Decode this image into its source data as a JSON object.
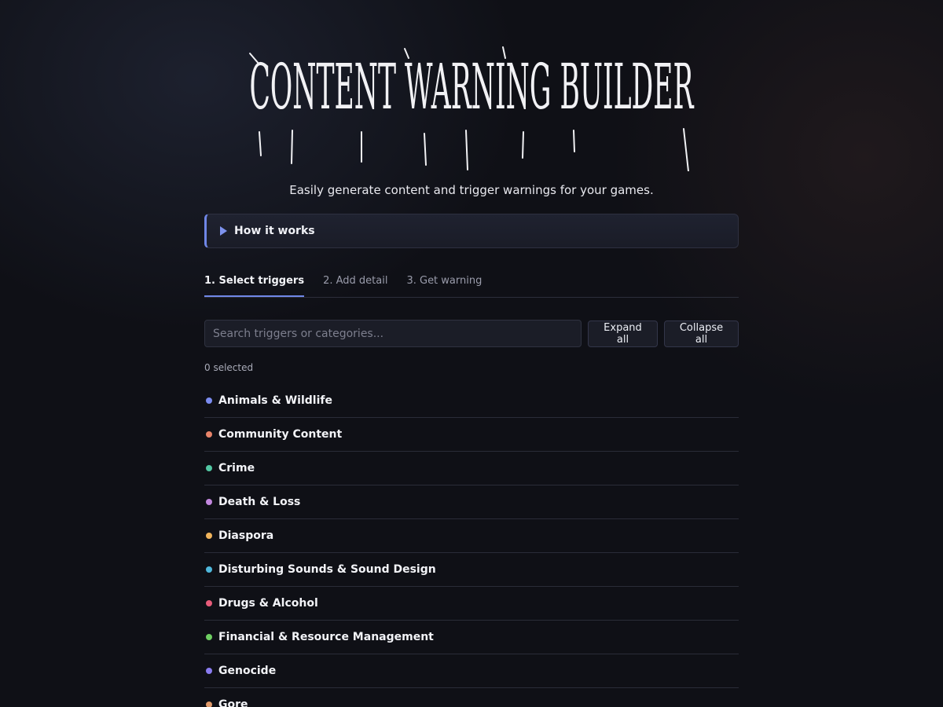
{
  "logo_text": "CONTENT WARNING BUILDER",
  "subtitle": "Easily generate content and trigger warnings for your games.",
  "how_it_works": {
    "label": "How it works"
  },
  "tabs": [
    {
      "label": "1. Select triggers",
      "active": true
    },
    {
      "label": "2. Add detail",
      "active": false
    },
    {
      "label": "3. Get warning",
      "active": false
    }
  ],
  "search": {
    "placeholder": "Search triggers or categories...",
    "value": ""
  },
  "buttons": {
    "expand_all": "Expand all",
    "collapse_all": "Collapse all"
  },
  "selected_count": "0 selected",
  "categories": [
    {
      "label": "Animals & Wildlife",
      "color": "#7b8cf0"
    },
    {
      "label": "Community Content",
      "color": "#e8846a"
    },
    {
      "label": "Crime",
      "color": "#52c7a3"
    },
    {
      "label": "Death & Loss",
      "color": "#c388df"
    },
    {
      "label": "Diaspora",
      "color": "#f0b45c"
    },
    {
      "label": "Disturbing Sounds & Sound Design",
      "color": "#4fb8dc"
    },
    {
      "label": "Drugs & Alcohol",
      "color": "#e85c7a"
    },
    {
      "label": "Financial & Resource Management",
      "color": "#6ecf62"
    },
    {
      "label": "Genocide",
      "color": "#8a7cf0"
    },
    {
      "label": "Gore",
      "color": "#e09a6a"
    }
  ]
}
